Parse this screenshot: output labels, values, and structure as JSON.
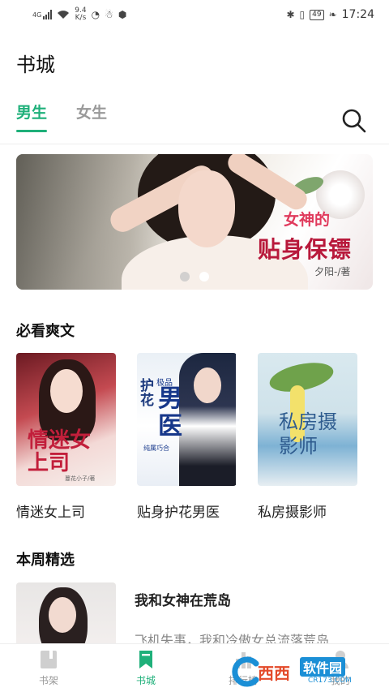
{
  "status_bar": {
    "signal_label": "4G",
    "net_speed_value": "9.4",
    "net_speed_unit": "K/s",
    "battery": "49",
    "time": "17:24"
  },
  "header": {
    "title": "书城",
    "tabs": [
      {
        "label": "男生",
        "active": true
      },
      {
        "label": "女生",
        "active": false
      }
    ]
  },
  "banner": {
    "subtitle": "女神的",
    "title": "贴身保镖",
    "author": "夕阳-/著",
    "dots": [
      false,
      true
    ]
  },
  "section_must_read": {
    "title": "必看爽文",
    "books": [
      {
        "title": "情迷女上司",
        "cover_title": "情迷女上司",
        "cover_author": "蔓花小子/著"
      },
      {
        "title": "贴身护花男医",
        "cover_title_small": "护花",
        "cover_title_big": "男医",
        "cover_tag": "极品",
        "cover_author": "纯属巧合"
      },
      {
        "title": "私房摄影师",
        "cover_title": "私房摄影师"
      }
    ]
  },
  "section_weekly": {
    "title": "本周精选",
    "items": [
      {
        "title": "我和女神在荒岛",
        "desc": "飞机失事，我和冷傲女总流落荒岛"
      }
    ]
  },
  "bottom_nav": {
    "items": [
      {
        "label": "书架",
        "icon": "bookshelf-icon",
        "active": false
      },
      {
        "label": "书城",
        "icon": "bookmark-icon",
        "active": true
      },
      {
        "label": "排行榜",
        "icon": "ranking-icon",
        "active": false
      },
      {
        "label": "我的",
        "icon": "profile-icon",
        "active": false
      }
    ]
  },
  "watermark": {
    "brand": "西西",
    "text": "软件园",
    "domain": "CR173.COM"
  },
  "colors": {
    "accent": "#1fb07a",
    "banner_title": "#b8193b"
  }
}
